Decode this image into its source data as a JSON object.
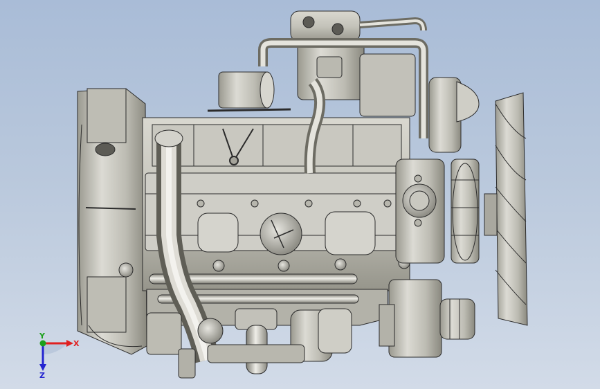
{
  "viewport": {
    "background_top": "#a9bcd7",
    "background_bottom": "#d2dbe8"
  },
  "model": {
    "body_color": "#c7c6bf",
    "shade_color": "#8f8e86",
    "edge_color": "#2b2b2b"
  },
  "triad": {
    "x_label": "X",
    "y_label": "Y",
    "z_label": "Z",
    "x_color": "#e02020",
    "y_color": "#1ca01c",
    "z_color": "#2424d0"
  }
}
